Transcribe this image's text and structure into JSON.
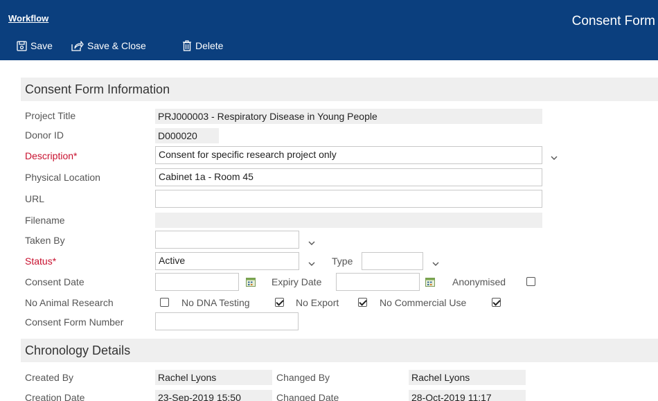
{
  "header": {
    "workflow_label": "Workflow",
    "title": "Consent Form",
    "toolbar": {
      "save_label": "Save",
      "save_close_label": "Save & Close",
      "delete_label": "Delete"
    }
  },
  "info_section": {
    "title": "Consent Form Information",
    "project_title": {
      "label": "Project Title",
      "value": "PRJ000003 - Respiratory Disease in Young People"
    },
    "donor_id": {
      "label": "Donor ID",
      "value": "D000020"
    },
    "description": {
      "label": "Description*",
      "value": "Consent for specific research project only"
    },
    "physical_location": {
      "label": "Physical Location",
      "value": "Cabinet 1a - Room 45"
    },
    "url": {
      "label": "URL",
      "value": ""
    },
    "filename": {
      "label": "Filename",
      "value": ""
    },
    "taken_by": {
      "label": "Taken By",
      "value": ""
    },
    "status": {
      "label": "Status*",
      "value": "Active"
    },
    "type": {
      "label": "Type",
      "value": ""
    },
    "consent_date": {
      "label": "Consent Date",
      "value": ""
    },
    "expiry_date": {
      "label": "Expiry Date",
      "value": ""
    },
    "anonymised": {
      "label": "Anonymised",
      "checked": false
    },
    "no_animal_research": {
      "label": "No Animal Research",
      "checked": false
    },
    "no_dna_testing": {
      "label": "No DNA Testing",
      "checked": true
    },
    "no_export": {
      "label": "No Export",
      "checked": true
    },
    "no_commercial_use": {
      "label": "No Commercial Use",
      "checked": true
    },
    "consent_form_number": {
      "label": "Consent Form Number",
      "value": ""
    }
  },
  "chronology_section": {
    "title": "Chronology Details",
    "created_by": {
      "label": "Created By",
      "value": "Rachel Lyons"
    },
    "changed_by": {
      "label": "Changed By",
      "value": "Rachel Lyons"
    },
    "creation_date": {
      "label": "Creation Date",
      "value": "23-Sep-2019 15:50"
    },
    "changed_date": {
      "label": "Changed Date",
      "value": "28-Oct-2019 11:17"
    }
  },
  "icons": [
    "save-icon",
    "save-close-icon",
    "delete-icon",
    "chevron-down-icon",
    "calendar-icon"
  ],
  "colors": {
    "header_bg": "#0b3f7e",
    "required": "#c8102e",
    "readonly_bg": "#efefef"
  }
}
